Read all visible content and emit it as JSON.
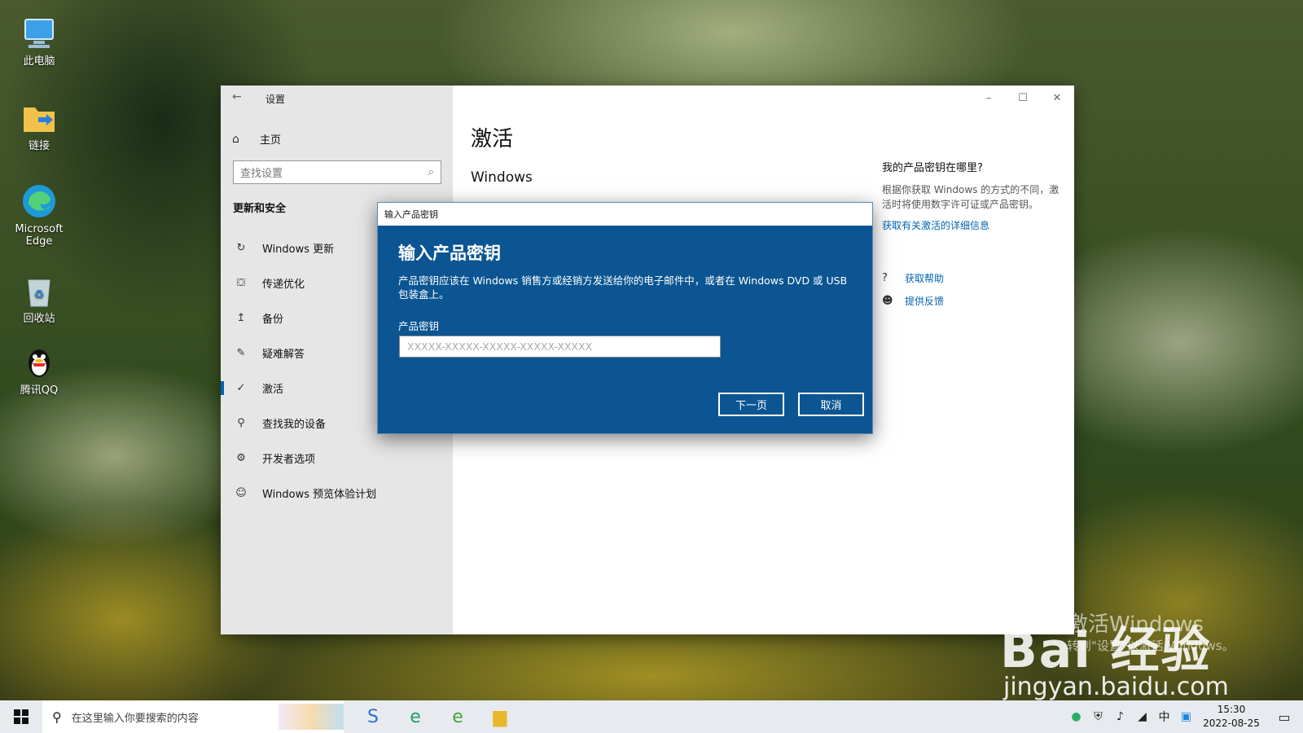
{
  "desktop": {
    "icons": [
      {
        "label": "此电脑",
        "icon": "computer-icon"
      },
      {
        "label": "链接",
        "icon": "folder-shortcut-icon"
      },
      {
        "label": "Microsoft Edge",
        "icon": "edge-icon"
      },
      {
        "label": "回收站",
        "icon": "recycle-bin-icon"
      },
      {
        "label": "腾讯QQ",
        "icon": "qq-penguin-icon"
      }
    ]
  },
  "window": {
    "title": "设置",
    "controls": {
      "minimize": "–",
      "maximize": "☐",
      "close": "✕"
    },
    "back": "←"
  },
  "sidebar": {
    "home": {
      "label": "主页",
      "icon": "⌂"
    },
    "search": {
      "placeholder": "查找设置",
      "icon": "⌕"
    },
    "section_title": "更新和安全",
    "items": [
      {
        "label": "Windows 更新",
        "icon": "↻",
        "active": false
      },
      {
        "label": "传递优化",
        "icon": "⛋",
        "active": false
      },
      {
        "label": "备份",
        "icon": "↥",
        "active": false
      },
      {
        "label": "疑难解答",
        "icon": "✎",
        "active": false
      },
      {
        "label": "激活",
        "icon": "✓",
        "active": true
      },
      {
        "label": "查找我的设备",
        "icon": "⚲",
        "active": false
      },
      {
        "label": "开发者选项",
        "icon": "⚙",
        "active": false
      },
      {
        "label": "Windows 预览体验计划",
        "icon": "☺",
        "active": false
      }
    ]
  },
  "main": {
    "title": "激活",
    "subtitle": "Windows"
  },
  "right_panel": {
    "title": "我的产品密钥在哪里?",
    "description": "根据你获取 Windows 的方式的不同，激活时将使用数字许可证或产品密钥。",
    "link": "获取有关激活的详细信息",
    "actions": [
      {
        "label": "获取帮助",
        "icon": "?"
      },
      {
        "label": "提供反馈",
        "icon": "☻"
      }
    ]
  },
  "dialog": {
    "titlebar": "输入产品密钥",
    "heading": "输入产品密钥",
    "description": "产品密钥应该在 Windows 销售方或经销方发送给你的电子邮件中，或者在 Windows DVD 或 USB 包装盒上。",
    "key_label": "产品密钥",
    "key_placeholder": "XXXXX-XXXXX-XXXXX-XXXXX-XXXXX",
    "key_value": "",
    "next_button": "下一页",
    "cancel_button": "取消"
  },
  "watermark": {
    "ghost_1": "激活Windows",
    "ghost_2": "转到\"设置\"以激活 Windows。",
    "logo": "Bai 经验",
    "url": "jingyan.baidu.com"
  },
  "taskbar": {
    "search_placeholder": "在这里输入你要搜索的内容",
    "apps": [
      {
        "icon": "sogou-icon",
        "glyph": "S",
        "color": "#2d6fd6"
      },
      {
        "icon": "edge-icon",
        "glyph": "e",
        "color": "#1e9e6d"
      },
      {
        "icon": "browser-360-icon",
        "glyph": "e",
        "color": "#43a73a"
      },
      {
        "icon": "file-explorer-icon",
        "glyph": "▆",
        "color": "#e8b82a"
      }
    ],
    "tray": {
      "icons": [
        "wechat-icon",
        "security-shield-icon",
        "volume-icon",
        "network-icon",
        "ime-icon",
        "qq-tray-icon"
      ],
      "time": "15:30",
      "date": "2022-08-25"
    }
  }
}
